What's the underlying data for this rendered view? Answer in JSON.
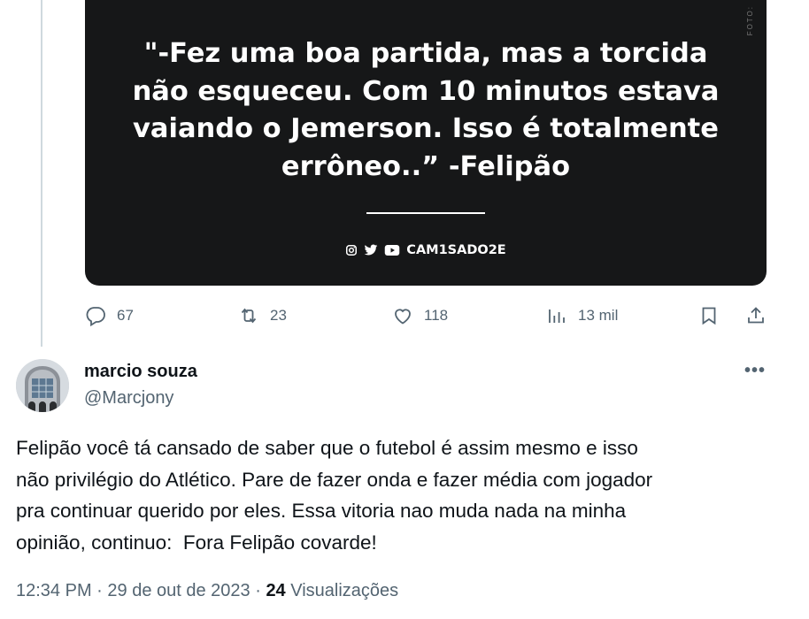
{
  "media": {
    "side_text": "FOTO:",
    "quote_lines": [
      "\"-Fez uma boa partida, mas a torcida",
      "não esqueceu. Com 10 minutos estava",
      "vaiando o Jemerson. Isso é totalmente",
      "errôneo..” -Felipão"
    ],
    "brand": "CAM1SADO2E",
    "brand_icons": [
      "instagram-icon",
      "twitter-icon",
      "youtube-icon"
    ]
  },
  "actions": {
    "replies": "67",
    "retweets": "23",
    "likes": "118",
    "views": "13 mil"
  },
  "reply": {
    "name": "marcio souza",
    "handle": "@Marcjony",
    "more": "•••",
    "text_lines": [
      "Felipão você tá cansado de saber que o futebol é assim mesmo e isso",
      "não privilégio do Atlético. Pare de fazer onda e fazer média com jogador",
      "pra continuar querido por eles. Essa vitoria nao muda nada na minha",
      "opinião, continuo:  Fora Felipão covarde!"
    ],
    "time": "12:34 PM",
    "sep": " · ",
    "date": "29 de out de 2023",
    "views_count": "24",
    "views_label": "Visualizações"
  },
  "colors": {
    "text": "#0f1419",
    "muted": "#536471",
    "media_bg": "#161718"
  }
}
